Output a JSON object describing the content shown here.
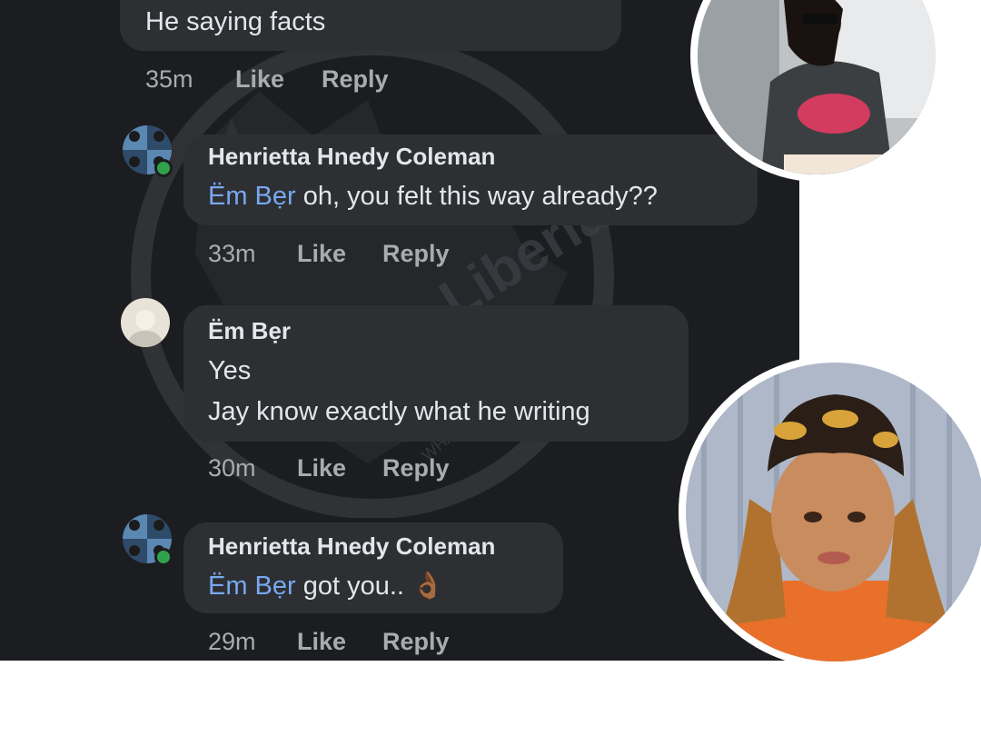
{
  "comments": [
    {
      "author": "",
      "mention": "",
      "text": "He saying facts",
      "time": "35m",
      "like": "Like",
      "reply": "Reply"
    },
    {
      "author": "Henrietta Hnedy Coleman",
      "mention": "Ëm Bẹr",
      "text": " oh, you felt this way already??",
      "time": "33m",
      "like": "Like",
      "reply": "Reply"
    },
    {
      "author": "Ëm Bẹr",
      "mention": "",
      "line1": "Yes",
      "line2": "Jay know exactly what he writing",
      "time": "30m",
      "like": "Like",
      "reply": "Reply"
    },
    {
      "author": "Henrietta Hnedy Coleman",
      "mention": "Ëm Bẹr",
      "text": " got you..",
      "emoji": "👌🏾",
      "time": "29m",
      "like": "Like",
      "reply": "Reply"
    }
  ],
  "watermark": {
    "text": "Naija Liberia",
    "tagline": "WHAT THE EYES CAN'T SEE"
  },
  "colors": {
    "background": "#1c1d20",
    "bubble": "#2d2f33",
    "mention": "#78a8f0",
    "meta": "#a9abaf"
  }
}
